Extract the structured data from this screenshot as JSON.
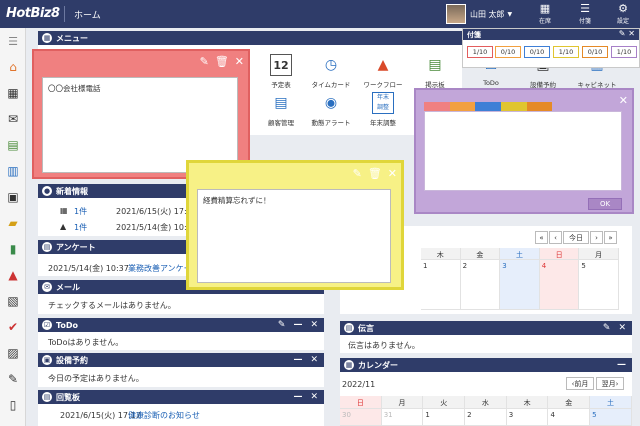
{
  "topbar": {
    "logo": "HotBiz8",
    "home": "ホーム",
    "user_name": "山田 太郎",
    "buttons": [
      {
        "label": "在席",
        "icon": "building-icon"
      },
      {
        "label": "付箋",
        "icon": "sticky-stack-icon"
      },
      {
        "label": "設定",
        "icon": "gear-icon"
      }
    ]
  },
  "sticky_panel": {
    "title": "付箋",
    "counters": [
      {
        "text": "1/10",
        "color": "#e35d5d"
      },
      {
        "text": "0/10",
        "color": "#f2a03f"
      },
      {
        "text": "0/10",
        "color": "#3e7fd6"
      },
      {
        "text": "1/10",
        "color": "#e0c530"
      },
      {
        "text": "0/10",
        "color": "#e58a27"
      },
      {
        "text": "1/10",
        "color": "#a780c8"
      }
    ]
  },
  "menu": {
    "title": "メニュー",
    "items": [
      {
        "label": "予定表",
        "icon": "calendar-12-icon"
      },
      {
        "label": "タイムカード",
        "icon": "time-card-icon"
      },
      {
        "label": "ワークフロー",
        "icon": "workflow-icon"
      },
      {
        "label": "掲示板",
        "icon": "bulletin-board-icon"
      },
      {
        "label": "ToDo",
        "icon": "todo-icon"
      },
      {
        "label": "設備予約",
        "icon": "facility-icon"
      },
      {
        "label": "キャビネット",
        "icon": "cabinet-icon"
      },
      {
        "label": "顧客管理",
        "icon": "customer-icon"
      },
      {
        "label": "動態アラート",
        "icon": "alert-icon"
      },
      {
        "label": "年末調整",
        "icon": "year-end-icon",
        "badge": "年末\n調整"
      }
    ]
  },
  "notes": {
    "red": {
      "text": "〇〇会社様電話"
    },
    "yellow": {
      "text": "経費精算忘れずに！"
    },
    "purple": {
      "ok_label": "OK"
    }
  },
  "news": {
    "title": "新着情報",
    "rows": [
      {
        "count": "1件",
        "date": "2021/6/15(火) 17:17"
      },
      {
        "count": "1件",
        "date": "2021/5/14(金) 10:37"
      }
    ]
  },
  "survey": {
    "title": "アンケート",
    "date": "2021/5/14(金) 10:37",
    "link": "業務改善アンケー"
  },
  "mail": {
    "title": "メール",
    "text": "チェックするメールはありません。"
  },
  "todo": {
    "title": "ToDo",
    "text": "ToDoはありません。"
  },
  "facility": {
    "title": "設備予約",
    "text": "今日の予定はありません。"
  },
  "board": {
    "title": "回覧板",
    "date": "2021/6/15(火) 17:17",
    "link": "健康診断のお知らせ"
  },
  "week_calendar": {
    "today_label": "今日",
    "days": [
      "木",
      "金",
      "土",
      "日",
      "月"
    ],
    "dates": [
      "1",
      "2",
      "3",
      "4",
      "5"
    ]
  },
  "memo": {
    "title": "伝言",
    "text": "伝言はありません。"
  },
  "calendar": {
    "title": "カレンダー",
    "month": "2022/11",
    "prev_label": "前月",
    "next_label": "翌月",
    "weekdays": [
      "日",
      "月",
      "火",
      "水",
      "木",
      "金",
      "土"
    ],
    "first_row": [
      "30",
      "31",
      "1",
      "2",
      "3",
      "4",
      "5"
    ]
  }
}
